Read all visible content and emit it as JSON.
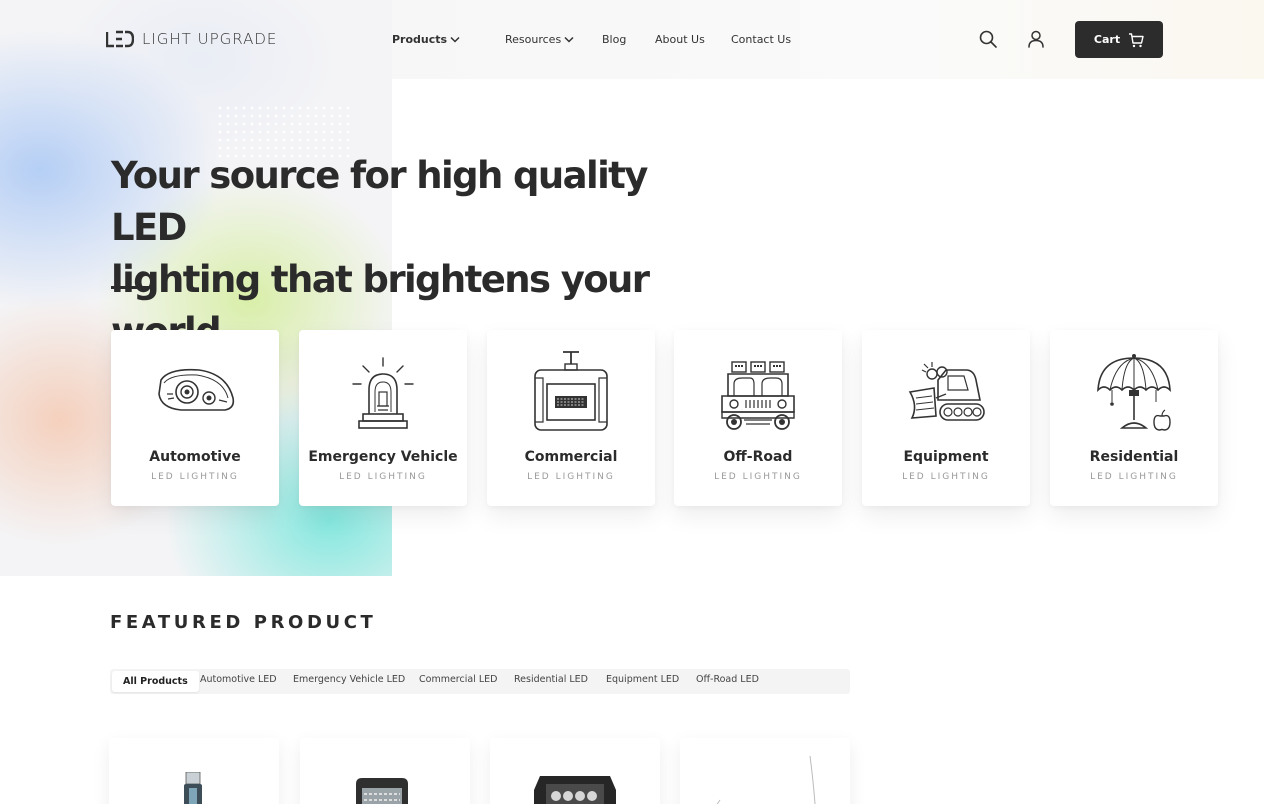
{
  "brand": {
    "name": "LIGHT UPGRADE",
    "logo_icon": "led-logo-icon"
  },
  "nav": {
    "items": [
      {
        "label": "Products",
        "active": true,
        "dropdown": true
      },
      {
        "label": "Resources",
        "active": false,
        "dropdown": true
      },
      {
        "label": "Blog",
        "active": false,
        "dropdown": false
      },
      {
        "label": "About Us",
        "active": false,
        "dropdown": false
      },
      {
        "label": "Contact Us",
        "active": false,
        "dropdown": false
      }
    ],
    "search_icon": "search-icon",
    "account_icon": "user-icon",
    "cart_label": "Cart",
    "cart_icon": "cart-icon"
  },
  "hero": {
    "title_line1": "Your source for high quality LED",
    "title_line2": "lighting that brightens your world"
  },
  "categories": [
    {
      "title": "Automotive",
      "subtitle": "LED LIGHTING",
      "icon": "headlight-icon"
    },
    {
      "title": "Emergency Vehicle",
      "subtitle": "LED LIGHTING",
      "icon": "beacon-light-icon"
    },
    {
      "title": "Commercial",
      "subtitle": "LED LIGHTING",
      "icon": "floodlight-icon"
    },
    {
      "title": "Off-Road",
      "subtitle": "LED LIGHTING",
      "icon": "jeep-icon"
    },
    {
      "title": "Equipment",
      "subtitle": "LED LIGHTING",
      "icon": "bulldozer-icon"
    },
    {
      "title": "Residential",
      "subtitle": "LED LIGHTING",
      "icon": "umbrella-lamp-icon"
    }
  ],
  "featured": {
    "heading": "FEATURED PRODUCT",
    "tabs": [
      "All Products",
      "Automotive LED",
      "Emergency Vehicle LED",
      "Commercial LED",
      "Residential LED",
      "Equipment LED",
      "Off-Road LED"
    ],
    "active_tab": "All Products"
  },
  "colors": {
    "primary_dark": "#2c2c2c",
    "text": "#2b2b2b",
    "muted": "#9a9a9a",
    "tab_bg": "#f4f4f5"
  }
}
